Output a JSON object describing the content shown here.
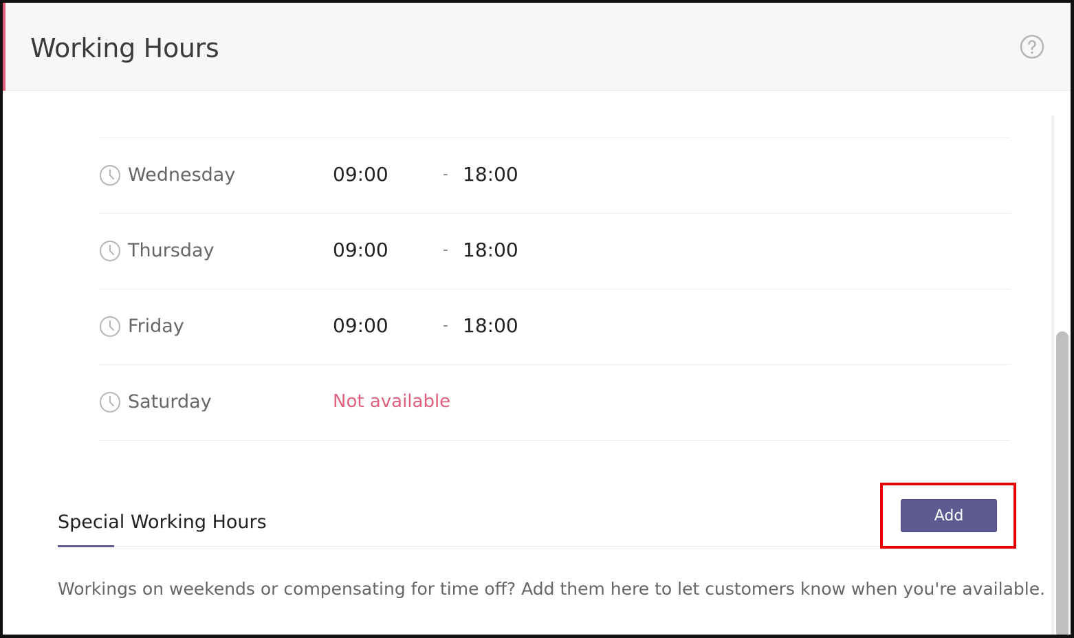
{
  "header": {
    "title": "Working Hours",
    "help_icon": "question-circle-icon"
  },
  "schedule": [
    {
      "day": "Wednesday",
      "start": "09:00",
      "separator": "-",
      "end": "18:00"
    },
    {
      "day": "Thursday",
      "start": "09:00",
      "separator": "-",
      "end": "18:00"
    },
    {
      "day": "Friday",
      "start": "09:00",
      "separator": "-",
      "end": "18:00"
    },
    {
      "day": "Saturday",
      "status": "Not available"
    }
  ],
  "special": {
    "title": "Special Working Hours",
    "add_label": "Add",
    "description": "Workings on weekends or compensating for time off? Add them here to let customers know when you're available."
  },
  "colors": {
    "accent": "#5e5a92",
    "unavailable": "#e0607e",
    "highlight": "#e60000"
  }
}
